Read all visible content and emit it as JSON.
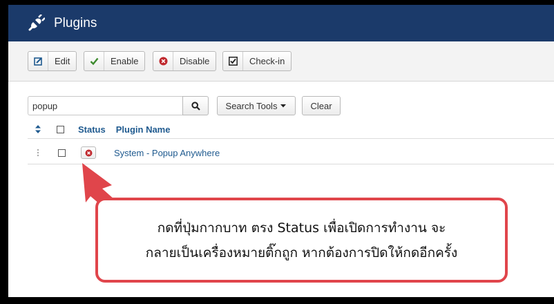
{
  "header": {
    "title": "Plugins",
    "icon": "plug-icon"
  },
  "toolbar": {
    "edit_label": "Edit",
    "enable_label": "Enable",
    "disable_label": "Disable",
    "checkin_label": "Check-in"
  },
  "filter": {
    "search_value": "popup",
    "search_tools_label": "Search Tools",
    "clear_label": "Clear"
  },
  "table": {
    "columns": {
      "status": "Status",
      "plugin_name": "Plugin Name"
    },
    "rows": [
      {
        "status": "disabled",
        "plugin_name": "System - Popup Anywhere"
      }
    ]
  },
  "callout": {
    "line1": "กดที่ปุ่มกากบาท ตรง Status เพื่อเปิดการทำงาน จะ",
    "line2": "กลายเป็นเครื่องหมายติ๊กถูก หากต้องการปิดให้กดอีกครั้ง"
  },
  "colors": {
    "header_bg": "#1b3a6a",
    "link": "#1f5a8f",
    "disabled_red": "#c0292e",
    "enable_green": "#3c8a2e",
    "callout_border": "#e0454b"
  }
}
